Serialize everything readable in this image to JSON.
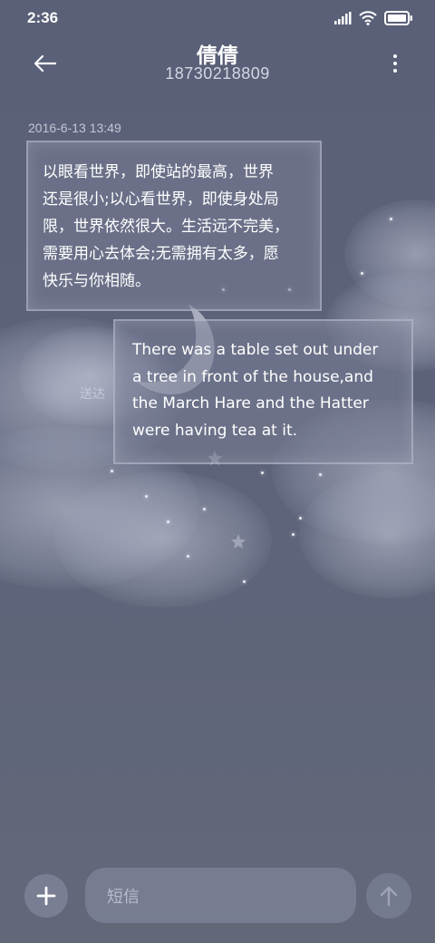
{
  "status_bar": {
    "time": "2:36",
    "icons": [
      "signal-icon",
      "wifi-icon",
      "battery-icon"
    ]
  },
  "header": {
    "contact_name": "倩倩",
    "phone_number": "18730218809",
    "back_icon": "arrow-left-icon",
    "more_icon": "more-vertical-icon"
  },
  "conversation": {
    "timestamp": "2016-6-13 13:49",
    "messages": [
      {
        "direction": "incoming",
        "lines": [
          "以眼看世界，即使站的最高，世界",
          "还是很小;以心看世界，即使身处局",
          "限，世界依然很大。生活远不完美，",
          "需要用心去体会;无需拥有太多，愿",
          "快乐与你相随。"
        ]
      },
      {
        "direction": "outgoing",
        "status": "送达",
        "lines": [
          "There was a table set out under",
          "a tree in front of the house,and",
          "the March Hare and the Hatter",
          "were having tea at it."
        ]
      }
    ]
  },
  "composer": {
    "placeholder": "短信",
    "add_icon": "plus-icon",
    "send_icon": "arrow-up-icon"
  },
  "colors": {
    "background": "#5c6279",
    "bubble_border": "#d2d6e6",
    "text": "#ffffff"
  }
}
